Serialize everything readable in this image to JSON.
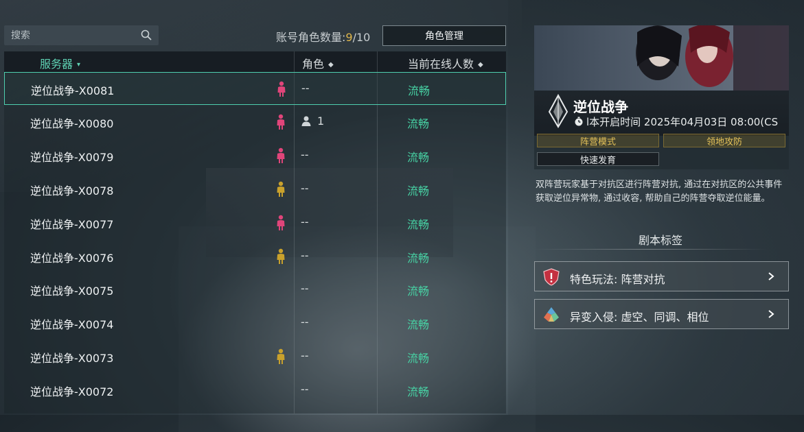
{
  "search": {
    "placeholder": "搜索"
  },
  "account": {
    "label": "账号角色数量:",
    "count": "9",
    "sep": "/",
    "max": "10"
  },
  "role_manage_button": "角色管理",
  "table": {
    "headers": {
      "server": "服务器",
      "role": "角色",
      "online": "当前在线人数"
    },
    "sort_icons": {
      "server": "▾",
      "role": "◆",
      "online": "◆"
    },
    "rows": [
      {
        "name": "逆位战争-X0081",
        "figure": "pink",
        "chars": "--",
        "status": "流畅"
      },
      {
        "name": "逆位战争-X0080",
        "figure": "pink",
        "chars": "1",
        "status": "流畅"
      },
      {
        "name": "逆位战争-X0079",
        "figure": "pink",
        "chars": "--",
        "status": "流畅"
      },
      {
        "name": "逆位战争-X0078",
        "figure": "gold",
        "chars": "--",
        "status": "流畅"
      },
      {
        "name": "逆位战争-X0077",
        "figure": "pink",
        "chars": "--",
        "status": "流畅"
      },
      {
        "name": "逆位战争-X0076",
        "figure": "gold",
        "chars": "--",
        "status": "流畅"
      },
      {
        "name": "逆位战争-X0075",
        "figure": "",
        "chars": "--",
        "status": "流畅"
      },
      {
        "name": "逆位战争-X0074",
        "figure": "",
        "chars": "--",
        "status": "流畅"
      },
      {
        "name": "逆位战争-X0073",
        "figure": "gold",
        "chars": "--",
        "status": "流畅"
      },
      {
        "name": "逆位战争-X0072",
        "figure": "",
        "chars": "--",
        "status": "流畅"
      }
    ]
  },
  "detail": {
    "title": "逆位战争",
    "open_time": "l本开启时间 2025年04月03日 08:00(CS",
    "tags": [
      "阵营模式",
      "领地攻防",
      "快速发育"
    ],
    "description": "双阵营玩家基于对抗区进行阵营对抗, 通过在对抗区的公共事件获取逆位异常物, 通过收容, 帮助自己的阵营夺取逆位能量。",
    "script_tags_title": "剧本标签",
    "features": [
      {
        "label": "特色玩法: 阵营对抗",
        "icon": "shield-icon"
      },
      {
        "label": "异变入侵: 虚空、同调、相位",
        "icon": "tetra-icon"
      }
    ]
  },
  "colors": {
    "accent": "#47d2a4",
    "selected_border": "#4fd0b0",
    "gold": "#e0b64a",
    "pink": "#e0457a",
    "figure_gold": "#c9a12c"
  }
}
